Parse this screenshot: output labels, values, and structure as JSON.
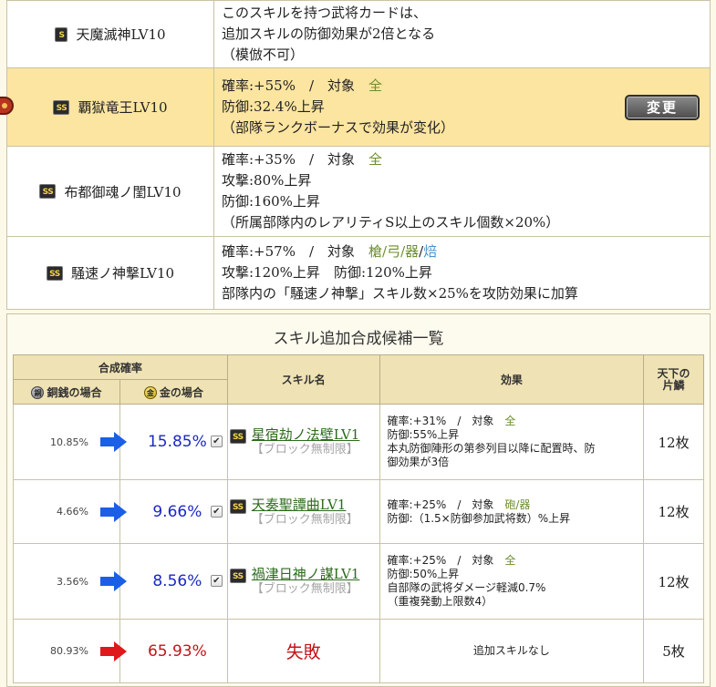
{
  "skills_table": {
    "rows": [
      {
        "rank": "S",
        "name": "天魔滅神LV10",
        "lines": [
          [
            {
              "t": "このスキルを持つ武将カードは、"
            }
          ],
          [
            {
              "t": "追加スキルの防御効果が2倍となる"
            }
          ],
          [
            {
              "t": "（模倣不可）"
            }
          ]
        ]
      },
      {
        "rank": "SS",
        "name": "覇獄竜王LV10",
        "selected": true,
        "lines": [
          [
            {
              "t": "確率:+55%　/　対象　"
            },
            {
              "t": "全",
              "c": "green"
            }
          ],
          [
            {
              "t": "防御:32.4%上昇"
            }
          ],
          [
            {
              "t": "（部隊ランクボーナスで効果が変化）"
            }
          ]
        ]
      },
      {
        "rank": "SS",
        "name": "布都御魂ノ閨LV10",
        "lines": [
          [
            {
              "t": "確率:+35%　/　対象　"
            },
            {
              "t": "全",
              "c": "green"
            }
          ],
          [
            {
              "t": "攻撃:80%上昇"
            }
          ],
          [
            {
              "t": "防御:160%上昇"
            }
          ],
          [
            {
              "t": "（所属部隊内のレアリティS以上のスキル個数×20%）"
            }
          ]
        ]
      },
      {
        "rank": "SS",
        "name": "騒速ノ神撃LV10",
        "lines": [
          [
            {
              "t": "確率:+57%　/　対象　"
            },
            {
              "t": "槍/弓/器",
              "c": "green"
            },
            {
              "t": "/"
            },
            {
              "t": "焙",
              "c": "blue"
            }
          ],
          [
            {
              "t": "攻撃:120%上昇　防御:120%上昇"
            }
          ],
          [
            {
              "t": "部隊内の「騒速ノ神撃」スキル数×25%を攻防効果に加算"
            }
          ]
        ]
      }
    ],
    "change_button": "変更"
  },
  "candidates": {
    "title": "スキル追加合成候補一覧",
    "headers": {
      "rate_group": "合成確率",
      "copper": "銅銭の場合",
      "copper_coin_glyph": "銅",
      "gold": "金の場合",
      "gold_coin_glyph": "金",
      "skill_name": "スキル名",
      "effect": "効果",
      "tenka_line1": "天下の",
      "tenka_line2": "片鱗"
    },
    "rows": [
      {
        "copper_rate": "10.85%",
        "gold_rate": "15.85%",
        "arrow_color": "blue",
        "checked": true,
        "rank": "SS",
        "skill": "星宿劫ノ法壁LV1",
        "skill_sub": "【ブロック無制限】",
        "effect": [
          [
            {
              "t": "確率:+31%　/　対象　"
            },
            {
              "t": "全",
              "c": "green"
            }
          ],
          [
            {
              "t": "防御:55%上昇"
            }
          ],
          [
            {
              "t": "本丸防御陣形の第参列目以降に配置時、防"
            }
          ],
          [
            {
              "t": "御効果が3倍"
            }
          ]
        ],
        "count": "12枚"
      },
      {
        "copper_rate": "4.66%",
        "gold_rate": "9.66%",
        "arrow_color": "blue",
        "checked": true,
        "rank": "SS",
        "skill": "天奏聖譚曲LV1",
        "skill_sub": "【ブロック無制限】",
        "effect": [
          [
            {
              "t": "確率:+25%　/　対象　"
            },
            {
              "t": "砲/器",
              "c": "green"
            }
          ],
          [
            {
              "t": "防御:（1.5×防御参加武将数）%上昇"
            }
          ]
        ],
        "count": "12枚"
      },
      {
        "copper_rate": "3.56%",
        "gold_rate": "8.56%",
        "arrow_color": "blue",
        "checked": true,
        "rank": "SS",
        "skill": "禍津日神ノ謀LV1",
        "skill_sub": "【ブロック無制限】",
        "effect": [
          [
            {
              "t": "確率:+25%　/　対象　"
            },
            {
              "t": "全",
              "c": "green"
            }
          ],
          [
            {
              "t": "防御:50%上昇"
            }
          ],
          [
            {
              "t": "自部隊の武将ダメージ軽減0.7%"
            }
          ],
          [
            {
              "t": "（重複発動上限数4）"
            }
          ]
        ],
        "count": "12枚"
      },
      {
        "copper_rate": "80.93%",
        "gold_rate": "65.93%",
        "arrow_color": "red",
        "checked": false,
        "fail_label": "失敗",
        "effect_plain": "追加スキルなし",
        "count": "5枚"
      }
    ]
  },
  "colors": {
    "accent_green": "#6c8e2c",
    "accent_blue": "#4a90c8",
    "selected_row": "#fbe5a0",
    "header_bg": "#efe2b4",
    "arrow_blue": "#1a5fe6",
    "arrow_red": "#e0181b",
    "fail_red": "#c4131a"
  }
}
